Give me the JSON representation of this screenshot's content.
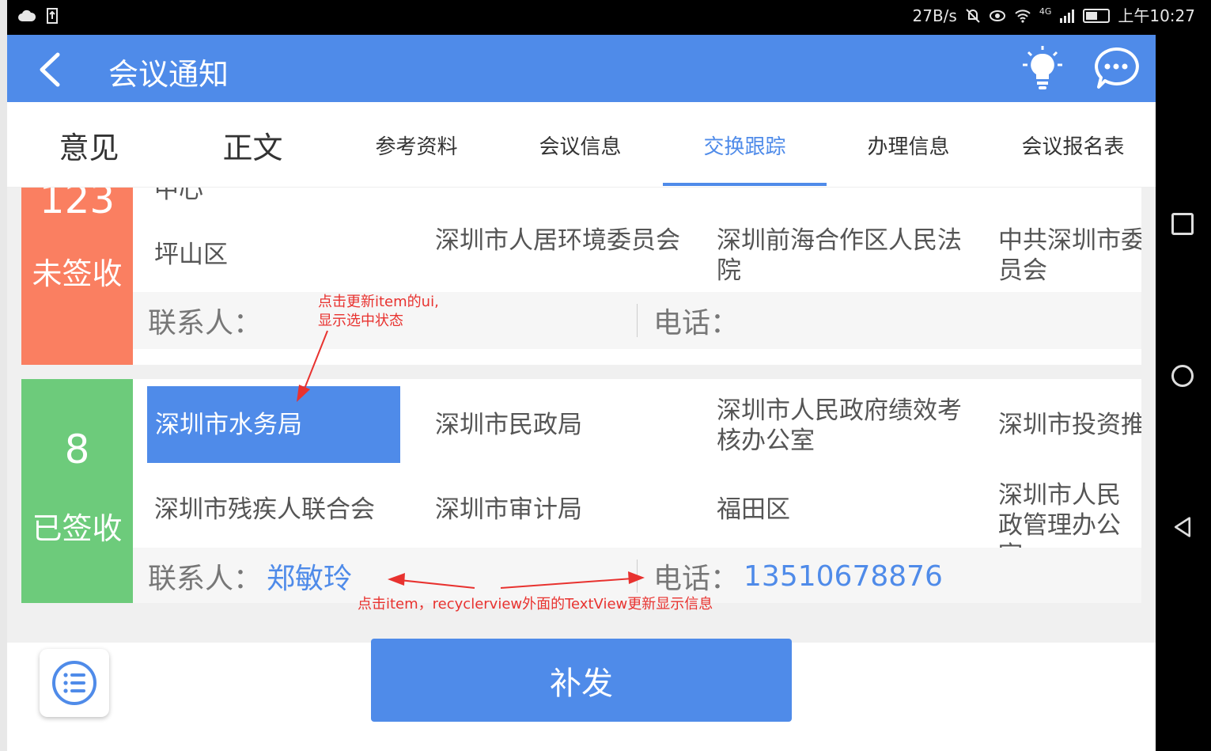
{
  "status_bar": {
    "speed": "27B/s",
    "network": "4G",
    "time": "上午10:27",
    "icons": [
      "cloud-icon",
      "upload-icon",
      "mute-icon",
      "eye-icon",
      "wifi-icon",
      "signal-icon",
      "battery-icon"
    ]
  },
  "app_bar": {
    "title": "会议通知",
    "icons": [
      "back-arrow-icon",
      "lightbulb-icon",
      "chat-bubble-icon"
    ],
    "color": "#4f8be9"
  },
  "tabs": [
    {
      "label": "意见"
    },
    {
      "label": "正文"
    },
    {
      "label": "参考资料"
    },
    {
      "label": "会议信息"
    },
    {
      "label": "交换跟踪",
      "active": true
    },
    {
      "label": "办理信息"
    },
    {
      "label": "会议报名表"
    }
  ],
  "cards": [
    {
      "count": "123",
      "status": "未签收",
      "status_color": "#fa7f61",
      "partial_top": "中心",
      "units": [
        "坪山区",
        "深圳市人居环境委员会",
        "深圳前海合作区人民法院",
        "中共深圳市委员会"
      ],
      "contact_label": "联系人：",
      "contact_value": "",
      "phone_label": "电话：",
      "phone_value": ""
    },
    {
      "count": "8",
      "status": "已签收",
      "status_color": "#6dcb7b",
      "units": [
        "深圳市水务局",
        "深圳市民政局",
        "深圳市人民政府绩效考核办公室",
        "深圳市投资推",
        "深圳市残疾人联合会",
        "深圳市审计局",
        "福田区",
        "深圳市人民政管理办公室"
      ],
      "contact_label": "联系人：",
      "contact_value": "郑敏玲",
      "phone_label": "电话：",
      "phone_value": "13510678876"
    }
  ],
  "annotations": {
    "item_ui": "点击更新item的ui,",
    "item_ui_2": "显示选中状态",
    "textview": "点击item，recyclerview外面的TextView更新显示信息"
  },
  "actions": {
    "list_icon": "list-icon",
    "reissue": "补发"
  },
  "nav_bar": {
    "icons": [
      "recent-apps-icon",
      "home-icon",
      "back-triangle-icon"
    ]
  }
}
